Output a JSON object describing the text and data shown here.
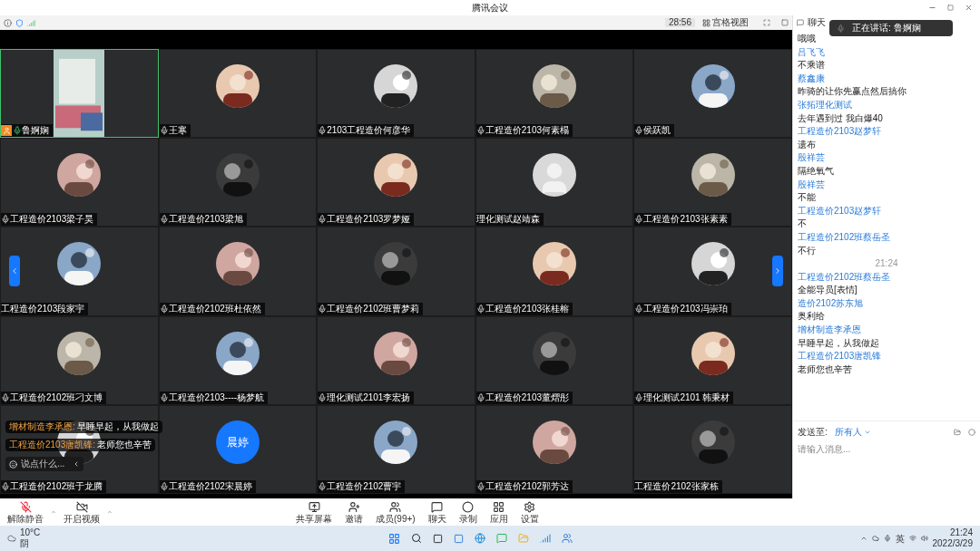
{
  "window": {
    "title": "腾讯会议"
  },
  "top_bar": {
    "timer": "28:56",
    "view_button": "宫格视图",
    "chat_tab": "聊天"
  },
  "speaking": {
    "label": "正在讲话: 鲁婀娴"
  },
  "tiles": [
    {
      "name": "鲁婀娴",
      "kind": "video",
      "mic": true,
      "host": true,
      "speaking": true
    },
    {
      "name": "王寒",
      "kind": "picture",
      "mic": true,
      "host": false,
      "speaking": false
    },
    {
      "name": "2103工程造价何彦华",
      "kind": "picture",
      "mic": true,
      "host": false,
      "speaking": false
    },
    {
      "name": "工程造价2103何素榻",
      "kind": "picture",
      "mic": true,
      "host": false,
      "speaking": false
    },
    {
      "name": "侯跃凯",
      "kind": "picture",
      "mic": true,
      "host": false,
      "speaking": false
    },
    {
      "name": "工程造价2103梁子昊",
      "kind": "picture",
      "mic": true,
      "host": false,
      "speaking": false
    },
    {
      "name": "工程造价2103梁旭",
      "kind": "picture",
      "mic": true,
      "host": false,
      "speaking": false
    },
    {
      "name": "工程造价2103罗梦娅",
      "kind": "picture",
      "mic": true,
      "host": false,
      "speaking": false
    },
    {
      "name": "理化测试赵靖森",
      "kind": "default",
      "mic": false,
      "host": false,
      "speaking": false
    },
    {
      "name": "工程造价2103张素素",
      "kind": "picture",
      "mic": true,
      "host": false,
      "speaking": false
    },
    {
      "name": "工程造价2103段家宇",
      "kind": "picture",
      "mic": false,
      "host": false,
      "speaking": false
    },
    {
      "name": "工程造价2102班杜依然",
      "kind": "picture",
      "mic": true,
      "host": false,
      "speaking": false
    },
    {
      "name": "工程造价2102班曹梦莉",
      "kind": "picture",
      "mic": true,
      "host": false,
      "speaking": false
    },
    {
      "name": "工程造价2103张桂榕",
      "kind": "picture",
      "mic": true,
      "host": false,
      "speaking": false
    },
    {
      "name": "工程造价2103冯崇珀",
      "kind": "picture",
      "mic": true,
      "host": false,
      "speaking": false
    },
    {
      "name": "工程造价2102班刁文博",
      "kind": "picture",
      "mic": true,
      "host": false,
      "speaking": false
    },
    {
      "name": "工程造价2103----杨梦航",
      "kind": "picture",
      "mic": true,
      "host": false,
      "speaking": false
    },
    {
      "name": "理化测试2101李宏扬",
      "kind": "picture",
      "mic": true,
      "host": false,
      "speaking": false
    },
    {
      "name": "工程造价2103董熠彤",
      "kind": "picture",
      "mic": true,
      "host": false,
      "speaking": false
    },
    {
      "name": "理化测试2101 韩秉材",
      "kind": "picture",
      "mic": true,
      "host": false,
      "speaking": false
    },
    {
      "name": "工程造价2102班于龙腾",
      "kind": "picture",
      "mic": true,
      "host": false,
      "speaking": false
    },
    {
      "name": "工程造价2102宋晨婷",
      "kind": "initials",
      "initials": "晨婷",
      "mic": true,
      "host": false,
      "speaking": false
    },
    {
      "name": "工程造价2102曹宇",
      "kind": "picture",
      "mic": true,
      "host": false,
      "speaking": false
    },
    {
      "name": "工程造价2102郭芳达",
      "kind": "picture",
      "mic": true,
      "host": false,
      "speaking": false
    },
    {
      "name": "工程造价2102张家栋",
      "kind": "picture",
      "mic": false,
      "host": false,
      "speaking": false
    }
  ],
  "floating_chat": {
    "messages": [
      {
        "sender": "增材制造李承恩:",
        "text": "早睡早起，从我做起"
      },
      {
        "sender": "工程造价2103唐凯锋:",
        "text": "老师您也辛苦"
      }
    ],
    "placeholder": "说点什么..."
  },
  "chat": {
    "items": [
      {
        "kind": "text",
        "text": "哦哦"
      },
      {
        "kind": "sender",
        "text": "吕飞飞"
      },
      {
        "kind": "text",
        "text": "不乘谱"
      },
      {
        "kind": "sender",
        "text": "蔡鑫康"
      },
      {
        "kind": "text",
        "text": "昨骑的让你先赢点然后搞你"
      },
      {
        "kind": "sender",
        "text": "张拓理化测试"
      },
      {
        "kind": "text",
        "text": "去年遇到过  我白爆40"
      },
      {
        "kind": "sender",
        "text": "工程造价2103赵梦轩"
      },
      {
        "kind": "text",
        "text": "遗布"
      },
      {
        "kind": "sender",
        "text": "殷祥芸"
      },
      {
        "kind": "text",
        "text": "隔绝氧气"
      },
      {
        "kind": "sender",
        "text": "殷祥芸"
      },
      {
        "kind": "text",
        "text": "不能"
      },
      {
        "kind": "sender",
        "text": "工程造价2103赵梦轩"
      },
      {
        "kind": "text",
        "text": "不"
      },
      {
        "kind": "sender",
        "text": "工程造价2102班蔡岳圣"
      },
      {
        "kind": "text",
        "text": "不行"
      },
      {
        "kind": "time",
        "text": "21:24"
      },
      {
        "kind": "sender",
        "text": "工程造价2102班蔡岳圣"
      },
      {
        "kind": "text",
        "text": "全能导员[表情]"
      },
      {
        "kind": "sender",
        "text": "造价2102苏东旭"
      },
      {
        "kind": "text",
        "text": "奥利给"
      },
      {
        "kind": "sender",
        "text": "增材制造李承恩"
      },
      {
        "kind": "text",
        "text": "早睡早起，从我做起"
      },
      {
        "kind": "sender",
        "text": "工程造价2103唐凯锋"
      },
      {
        "kind": "text",
        "text": "老师您也辛苦"
      }
    ],
    "send_to_label": "发送至:",
    "recipient": "所有人",
    "placeholder": "请输入消息..."
  },
  "toolbar": {
    "left": [
      {
        "kind": "mic",
        "label": "解除静音"
      },
      {
        "kind": "camera",
        "label": "开启视频"
      }
    ],
    "center": [
      {
        "kind": "share",
        "label": "共享屏幕"
      },
      {
        "kind": "invite",
        "label": "邀请"
      },
      {
        "kind": "members",
        "label": "成员(99+)"
      },
      {
        "kind": "chat",
        "label": "聊天"
      },
      {
        "kind": "record",
        "label": "录制"
      },
      {
        "kind": "apps",
        "label": "应用"
      },
      {
        "kind": "settings",
        "label": "设置"
      }
    ]
  },
  "taskbar": {
    "temperature": "10°C",
    "weather": "阴",
    "input_method": "英",
    "time": "21:24",
    "date": "2022/3/29"
  }
}
